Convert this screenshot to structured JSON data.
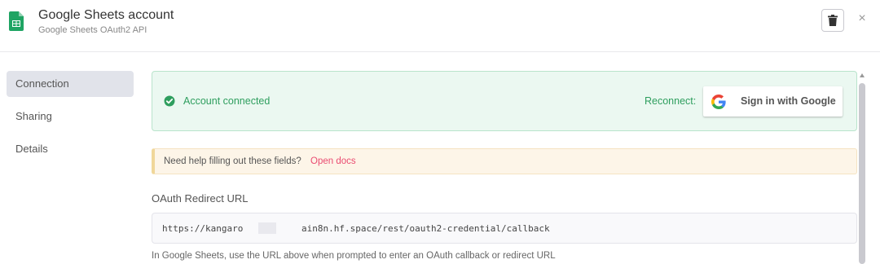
{
  "header": {
    "title": "Google Sheets account",
    "subtitle": "Google Sheets OAuth2 API",
    "icons": {
      "app": "google-sheets-icon",
      "delete": "trash-icon",
      "close": "close-icon"
    },
    "close_glyph": "×"
  },
  "sidebar": {
    "items": [
      {
        "label": "Connection",
        "active": true
      },
      {
        "label": "Sharing",
        "active": false
      },
      {
        "label": "Details",
        "active": false
      }
    ]
  },
  "status": {
    "message": "Account connected",
    "reconnect_label": "Reconnect:",
    "google_button_label": "Sign in with Google",
    "color": "#2e9e5e"
  },
  "help": {
    "text": "Need help filling out these fields?",
    "link": "Open docs",
    "link_color": "#ea4b71"
  },
  "oauth": {
    "label": "OAuth Redirect URL",
    "url_start": "https://kangaro",
    "url_end": "ain8n.hf.space/rest/oauth2-credential/callback",
    "hint": "In Google Sheets, use the URL above when prompted to enter an OAuth callback or redirect URL"
  }
}
